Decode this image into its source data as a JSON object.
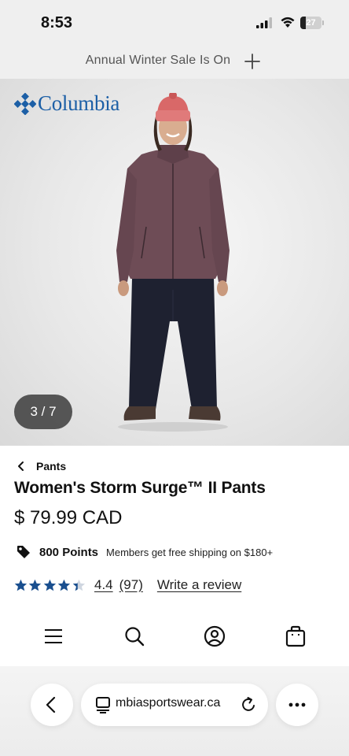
{
  "status_bar": {
    "time": "8:53",
    "battery_level": "27",
    "battery_fraction": 0.27,
    "icons": [
      "signal-icon",
      "wifi-icon",
      "battery-icon"
    ]
  },
  "promo": {
    "text": "Annual Winter Sale Is On",
    "icon": "plus-icon"
  },
  "hero": {
    "logo_text": "Columbia",
    "image_counter": "3 / 7"
  },
  "product": {
    "breadcrumb": "Pants",
    "title": "Women's Storm Surge™ II Pants",
    "price": "$ 79.99 CAD",
    "points": "800 Points",
    "shipping_note": "Members get free shipping on $180+",
    "rating": "4.4",
    "rating_value": 4.4,
    "review_count": "(97)",
    "write_review": "Write a review"
  },
  "bottom_nav": {
    "items": [
      "menu-icon",
      "search-icon",
      "account-icon",
      "cart-icon"
    ]
  },
  "browser": {
    "url": "mbiasportswear.ca",
    "icons": [
      "back-icon",
      "reader-icon",
      "reload-icon",
      "more-icon"
    ]
  },
  "colors": {
    "brand_blue": "#1c5fa6",
    "star_blue": "#1a4f8f",
    "promo_bg": "#efefef",
    "counter_bg": "#3c3c3c"
  }
}
